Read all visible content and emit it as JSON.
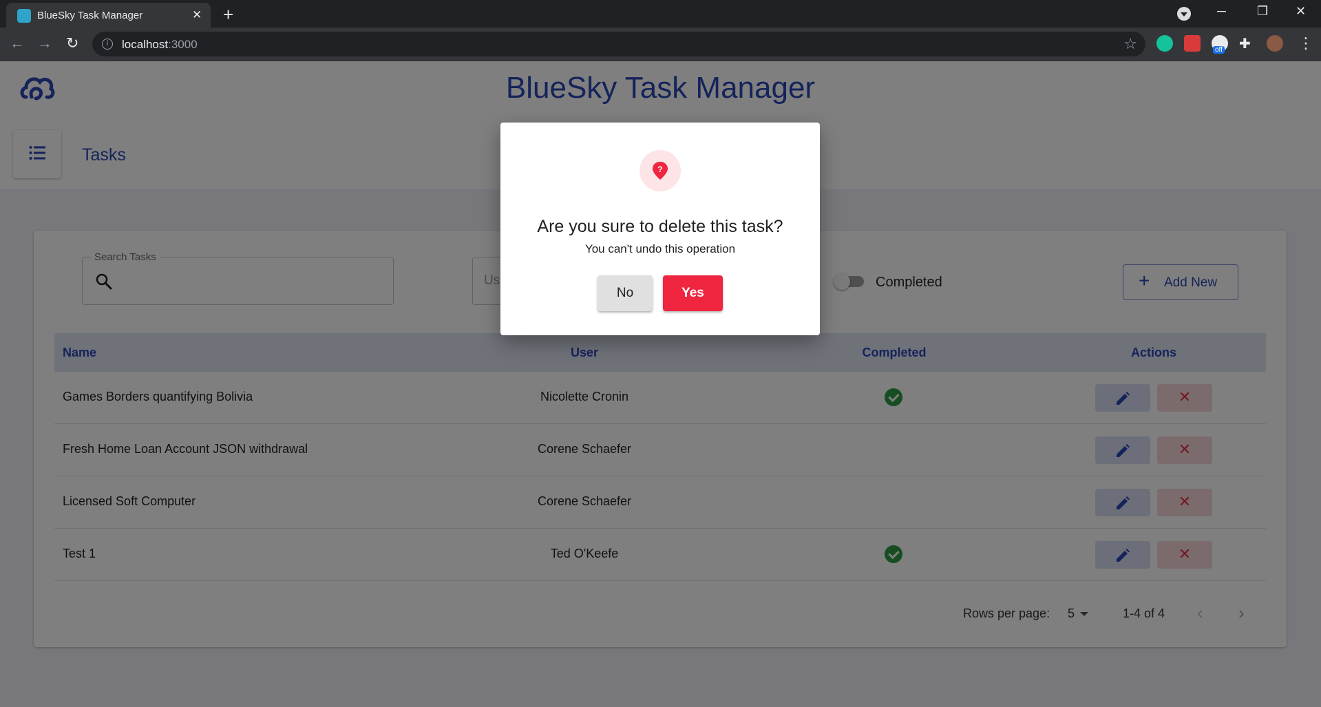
{
  "browser": {
    "tab_title": "BlueSky Task Manager",
    "url_host": "localhost",
    "url_port": ":3000",
    "ext_badge": "off"
  },
  "app": {
    "title": "BlueSky Task Manager",
    "accent_color": "#2a46b7"
  },
  "page_header": {
    "title": "Tasks"
  },
  "filters": {
    "search_label": "Search Tasks",
    "search_value": "",
    "user_placeholder": "Us",
    "completed_label": "Completed",
    "completed_on": false,
    "add_new_label": "Add New"
  },
  "table": {
    "headers": {
      "name": "Name",
      "user": "User",
      "completed": "Completed",
      "actions": "Actions"
    },
    "rows": [
      {
        "name": "Games Borders quantifying Bolivia",
        "user": "Nicolette Cronin",
        "completed": true
      },
      {
        "name": "Fresh Home Loan Account JSON withdrawal",
        "user": "Corene Schaefer",
        "completed": false
      },
      {
        "name": "Licensed Soft Computer",
        "user": "Corene Schaefer",
        "completed": false
      },
      {
        "name": "Test 1",
        "user": "Ted O'Keefe",
        "completed": true
      }
    ]
  },
  "pagination": {
    "rows_per_page_label": "Rows per page:",
    "rows_per_page": "5",
    "range": "1-4 of 4"
  },
  "dialog": {
    "title": "Are you sure to delete this task?",
    "subtitle": "You can't undo this operation",
    "no_label": "No",
    "yes_label": "Yes",
    "danger_color": "#f0253f"
  }
}
